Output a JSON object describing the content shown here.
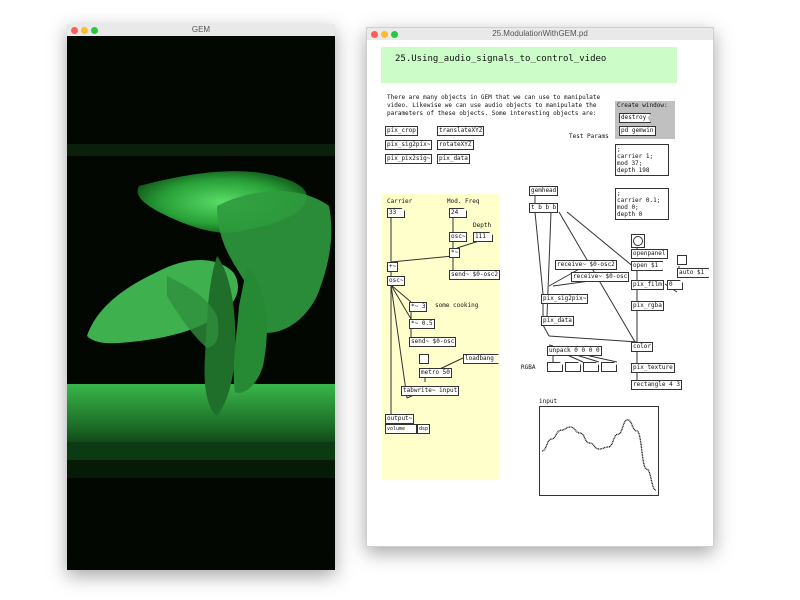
{
  "gem_window": {
    "title": "GEM"
  },
  "pd_window": {
    "title": "25.ModulationWithGEM.pd"
  },
  "heading": "25.Using_audio_signals_to_control_video",
  "intro_lines": [
    "There are many objects in GEM that we can use to manipulate",
    "video. Likewise we can use audio objects to manipulate the",
    "parameters of these objects. Some interesting objects are:"
  ],
  "interesting_objects": [
    "pix_crop",
    "translateXYZ",
    "pix_sig2pix~",
    "rotateXYZ",
    "pix_pix2sig~",
    "pix_data"
  ],
  "create_window": {
    "label": "Create window:",
    "destroy": "destroy",
    "gemwin": "pd gemwin"
  },
  "test_params": {
    "label": "Test Params",
    "preset1": [
      ";",
      "carrier 1;",
      "mod 37;",
      "depth 198"
    ],
    "preset2": [
      ";",
      "carrier 0.1;",
      "mod 0;",
      "depth 0"
    ]
  },
  "synth": {
    "carrier_label": "Carrier",
    "carrier_value": "33",
    "modfreq_label": "Mod. Freq",
    "modfreq_value": "24",
    "depth_label": "Depth",
    "depth_value": "111",
    "osc_mod": "osc~",
    "mul": "*~",
    "send_mod": "send~ $0-osc2",
    "plus": "+~",
    "osc_car": "osc~",
    "some_cooking": "some cooking",
    "mul_sig": "*~ 3",
    "mul_half": "*~ 0.5",
    "send_osc": "send~ $0-osc",
    "loadbang": "loadbang",
    "metro": "metro 50",
    "tabwrite": "tabwrite~ input",
    "output": "output~",
    "volume": "volume",
    "dsp": "dsp"
  },
  "gem_chain": {
    "gemhead": "gemhead",
    "trigger": "t b b b",
    "receive_osc2": "receive~ $0-osc2",
    "receive_osc": "receive~ $0-osc",
    "pix_sig2pix": "pix_sig2pix~",
    "pix_data": "pix_data",
    "unpack": "unpack 0 0 0 0",
    "rgba_label": "RGBA",
    "openpanel": "openpanel",
    "open": "open $1",
    "auto": "auto $1",
    "pix_film": "pix_film",
    "pix_film_num": "0",
    "pix_rgba": "pix_rgba",
    "color": "color",
    "pix_texture": "pix_texture",
    "rectangle": "rectangle 4 3"
  },
  "array": {
    "label": "input",
    "values": [
      0.0,
      0.3,
      0.52,
      0.6,
      0.45,
      0.2,
      0.05,
      0.1,
      0.42,
      0.78,
      0.5,
      -0.45,
      -0.98
    ]
  }
}
